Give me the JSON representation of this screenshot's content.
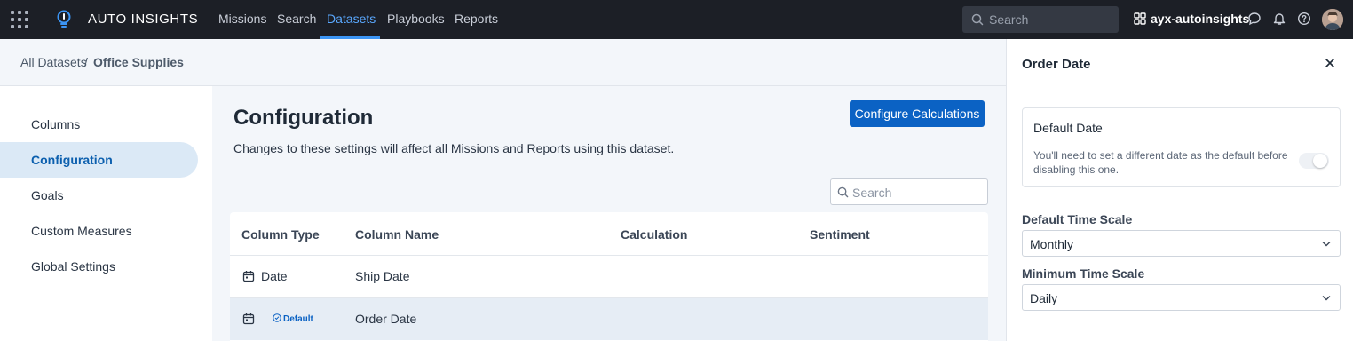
{
  "nav": {
    "brand": "AUTO INSIGHTS",
    "links": [
      {
        "label": "Missions",
        "active": false
      },
      {
        "label": "Search",
        "active": false
      },
      {
        "label": "Datasets",
        "active": true
      },
      {
        "label": "Playbooks",
        "active": false
      },
      {
        "label": "Reports",
        "active": false
      }
    ],
    "search_placeholder": "Search",
    "org_name": "ayx-autoinsights",
    "icons": [
      "apps-grid-icon",
      "lightbulb-logo-icon",
      "search-icon",
      "org-icon",
      "chat-icon",
      "bell-icon",
      "help-icon",
      "avatar"
    ]
  },
  "breadcrumb": {
    "root": "All Datasets",
    "separator": "/",
    "current": "Office Supplies"
  },
  "sidebar": {
    "items": [
      {
        "label": "Columns",
        "active": false
      },
      {
        "label": "Configuration",
        "active": true
      },
      {
        "label": "Goals",
        "active": false
      },
      {
        "label": "Custom Measures",
        "active": false
      },
      {
        "label": "Global Settings",
        "active": false
      }
    ]
  },
  "main": {
    "title": "Configuration",
    "description": "Changes to these settings will affect all Missions and Reports using this dataset.",
    "configure_button": "Configure Calculations",
    "search_placeholder": "Search",
    "table": {
      "columns": [
        "Column Type",
        "Column Name",
        "Calculation",
        "Sentiment"
      ],
      "rows": [
        {
          "type": "Date",
          "badge": "",
          "name": "Ship Date",
          "calculation": "",
          "sentiment": "",
          "selected": false
        },
        {
          "type": "",
          "badge": "Default",
          "name": "Order Date",
          "calculation": "",
          "sentiment": "",
          "selected": true
        }
      ]
    }
  },
  "panel": {
    "title": "Order Date",
    "default_date": {
      "title": "Default Date",
      "help": "You'll need to set a different date as the default before disabling this one.",
      "toggle_on": true,
      "toggle_disabled": true
    },
    "time_scale_label": "Default Time Scale",
    "time_scale_value": "Monthly",
    "min_time_scale_label": "Minimum Time Scale",
    "min_time_scale_value": "Daily"
  },
  "colors": {
    "nav_bg": "#1c1f26",
    "accent": "#0b62c4",
    "active_link": "#5aa9ff",
    "sidebar_active_bg": "#dbe9f6",
    "page_bg": "#f3f6fa"
  }
}
